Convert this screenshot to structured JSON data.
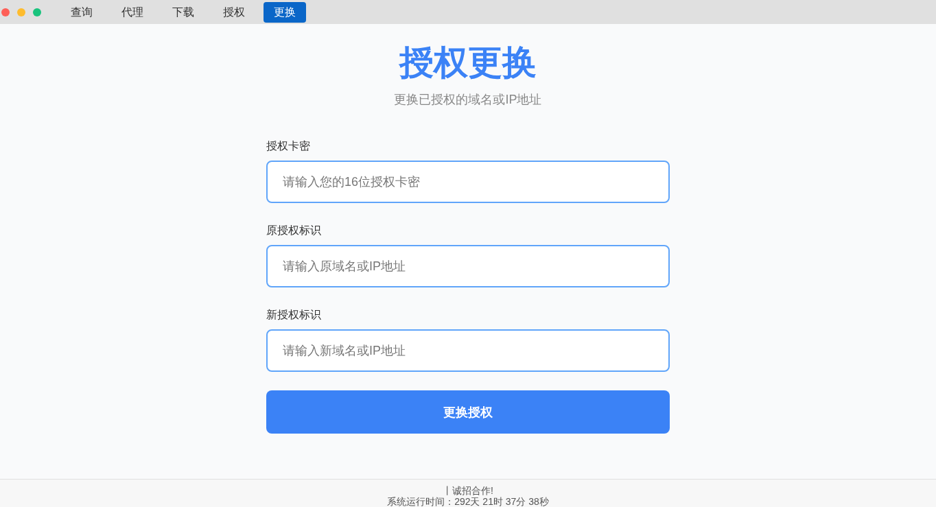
{
  "tabs": [
    {
      "label": "查询",
      "selected": false
    },
    {
      "label": "代理",
      "selected": false
    },
    {
      "label": "下载",
      "selected": false
    },
    {
      "label": "授权",
      "selected": false
    },
    {
      "label": "更换",
      "selected": true
    }
  ],
  "title": "授权更换",
  "subtitle": "更换已授权的域名或IP地址",
  "fields": [
    {
      "label": "授权卡密",
      "placeholder": "请输入您的16位授权卡密"
    },
    {
      "label": "原授权标识",
      "placeholder": "请输入原域名或IP地址"
    },
    {
      "label": "新授权标识",
      "placeholder": "请输入新域名或IP地址"
    }
  ],
  "submit": "更换授权",
  "footer": {
    "slogan": "丨诚招合作!",
    "uptime": "系统运行时间：292天 21时 37分 38秒"
  }
}
